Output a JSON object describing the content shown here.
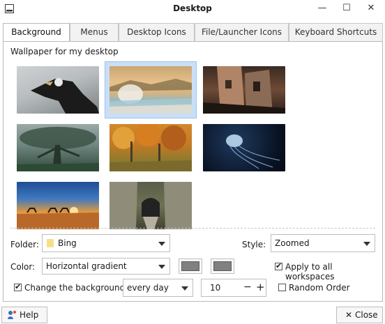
{
  "window": {
    "title": "Desktop",
    "minimize_glyph": "—",
    "maximize_glyph": "☐",
    "close_glyph": "✕"
  },
  "tabs": [
    {
      "label": "Background",
      "active": true
    },
    {
      "label": "Menus",
      "active": false
    },
    {
      "label": "Desktop Icons",
      "active": false
    },
    {
      "label": "File/Launcher Icons",
      "active": false
    },
    {
      "label": "Keyboard Shortcuts",
      "active": false
    }
  ],
  "background": {
    "section_label": "Wallpaper for my desktop",
    "wallpapers": [
      {
        "name": "wallpaper-condor",
        "selected": false
      },
      {
        "name": "wallpaper-hot-spring",
        "selected": true
      },
      {
        "name": "wallpaper-old-building",
        "selected": false
      },
      {
        "name": "wallpaper-foggy-tree",
        "selected": false
      },
      {
        "name": "wallpaper-autumn-forest",
        "selected": false
      },
      {
        "name": "wallpaper-jellyfish",
        "selected": false
      },
      {
        "name": "wallpaper-desert-camels",
        "selected": false
      },
      {
        "name": "wallpaper-rock-tunnel",
        "selected": false
      }
    ],
    "folder_label": "Folder:",
    "folder_value": "Bing",
    "style_label": "Style:",
    "style_value": "Zoomed",
    "color_label": "Color:",
    "color_value": "Horizontal gradient",
    "color1": "#808080",
    "color2": "#808080",
    "apply_all_label": "Apply to all workspaces",
    "apply_all_checked": true,
    "change_bg_label": "Change the background",
    "change_bg_checked": true,
    "interval_value": "every day",
    "interval_number": "10",
    "minus_glyph": "−",
    "plus_glyph": "+",
    "random_label": "Random Order",
    "random_checked": false
  },
  "footer": {
    "help_label": "Help",
    "close_label": "Close"
  }
}
